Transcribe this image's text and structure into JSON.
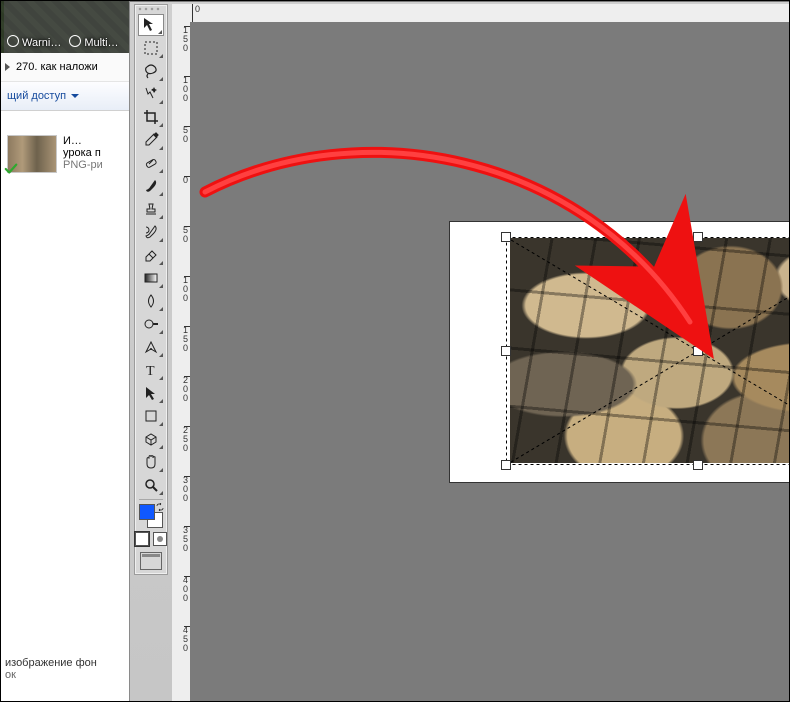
{
  "explorer": {
    "thumb_labels": [
      "Warni…",
      "Multi…"
    ],
    "nav_text": "270. как наложи",
    "share_label": "щий доступ",
    "file": {
      "line1": "И…",
      "line2": "урока п",
      "line3": "PNG-ри"
    },
    "footer_line1": "изображение фон",
    "footer_line2": "ок"
  },
  "ruler": {
    "v_labels": [
      "1\n5\n0",
      "1\n0\n0",
      "5\n0",
      "0",
      "5\n0",
      "1\n0\n0",
      "1\n5\n0",
      "2\n0\n0",
      "2\n5\n0",
      "3\n0\n0",
      "3\n5\n0",
      "4\n0\n0",
      "4\n5\n0"
    ],
    "h_label": "0"
  },
  "tools": [
    {
      "name": "move-tool",
      "selected": true,
      "svg": "move"
    },
    {
      "name": "marquee-tool",
      "svg": "marquee"
    },
    {
      "name": "lasso-tool",
      "svg": "lasso"
    },
    {
      "name": "quick-select-tool",
      "svg": "wand"
    },
    {
      "name": "crop-tool",
      "svg": "crop"
    },
    {
      "name": "eyedropper-tool",
      "svg": "eyedrop"
    },
    {
      "name": "healing-brush-tool",
      "svg": "bandaid"
    },
    {
      "name": "brush-tool",
      "svg": "brush"
    },
    {
      "name": "stamp-tool",
      "svg": "stamp"
    },
    {
      "name": "history-brush-tool",
      "svg": "hbrush"
    },
    {
      "name": "eraser-tool",
      "svg": "eraser"
    },
    {
      "name": "gradient-tool",
      "svg": "gradient"
    },
    {
      "name": "blur-tool",
      "svg": "blur"
    },
    {
      "name": "dodge-tool",
      "svg": "dodge"
    },
    {
      "name": "pen-tool",
      "svg": "pen"
    },
    {
      "name": "type-tool",
      "svg": "type"
    },
    {
      "name": "path-select-tool",
      "svg": "pathsel"
    },
    {
      "name": "shape-tool",
      "svg": "shape"
    },
    {
      "name": "3d-tool",
      "svg": "three"
    },
    {
      "name": "hand-tool",
      "svg": "hand"
    },
    {
      "name": "zoom-tool",
      "svg": "zoom"
    }
  ],
  "colors": {
    "foreground": "#1058ff",
    "background": "#ffffff"
  }
}
